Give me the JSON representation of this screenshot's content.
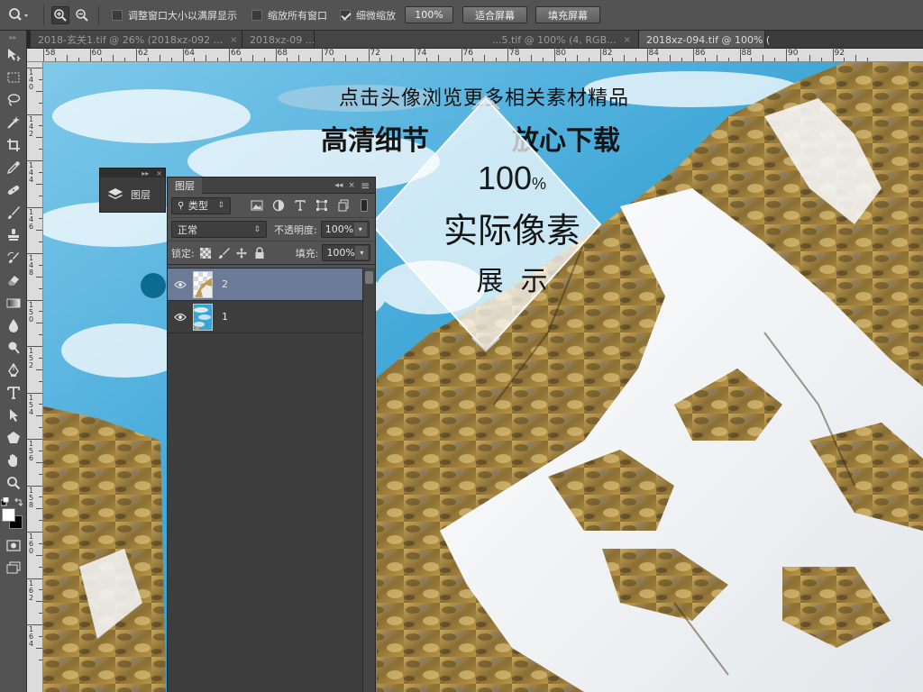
{
  "options_bar": {
    "tool_icon": "zoom-tool-icon",
    "zoom_in_icon": "zoom-in-icon",
    "zoom_out_icon": "zoom-out-icon",
    "resize_windows_label": "调整窗口大小以满屏显示",
    "resize_windows_checked": false,
    "zoom_all_label": "缩放所有窗口",
    "zoom_all_checked": false,
    "scrubby_label": "细微缩放",
    "scrubby_checked": true,
    "btn_100": "100%",
    "btn_fit": "适合屏幕",
    "btn_fill": "填充屏幕"
  },
  "tabs": [
    {
      "label": "2018-玄关1.tif @ 26% (2018xz-092 ..."
    },
    {
      "label": "2018xz-09 ..."
    },
    {
      "label": "...5.tif @ 100% (4, RGB..."
    },
    {
      "label": "2018xz-094.tif @ 100% ("
    }
  ],
  "ruler_top": [
    "58",
    "60",
    "62",
    "64",
    "66",
    "68",
    "70",
    "72",
    "74",
    "76",
    "78",
    "80",
    "82",
    "84",
    "86",
    "88",
    "90",
    "92"
  ],
  "ruler_left": [
    "140",
    "142",
    "144",
    "146",
    "148",
    "150",
    "152",
    "154",
    "156",
    "158",
    "160",
    "162",
    "164"
  ],
  "promo": {
    "line1": "点击头像浏览更多相关素材精品",
    "line2a": "高清细节",
    "line2b": "放心下载",
    "big_num": "100",
    "big_unit": "%",
    "big_text": "实际像素",
    "small_text": "展  示"
  },
  "mini_panel": {
    "label": "图层"
  },
  "layers_panel": {
    "title": "图层",
    "filter_kind": "类型",
    "blend_mode": "正常",
    "opacity_label": "不透明度:",
    "opacity_value": "100%",
    "lock_label": "锁定:",
    "fill_label": "填充:",
    "fill_value": "100%",
    "layers": [
      {
        "name": "2",
        "selected": true
      },
      {
        "name": "1",
        "selected": false
      }
    ]
  },
  "colors": {
    "foreground": "#ffffff",
    "background": "#000000",
    "selection": "#6b7a96"
  }
}
